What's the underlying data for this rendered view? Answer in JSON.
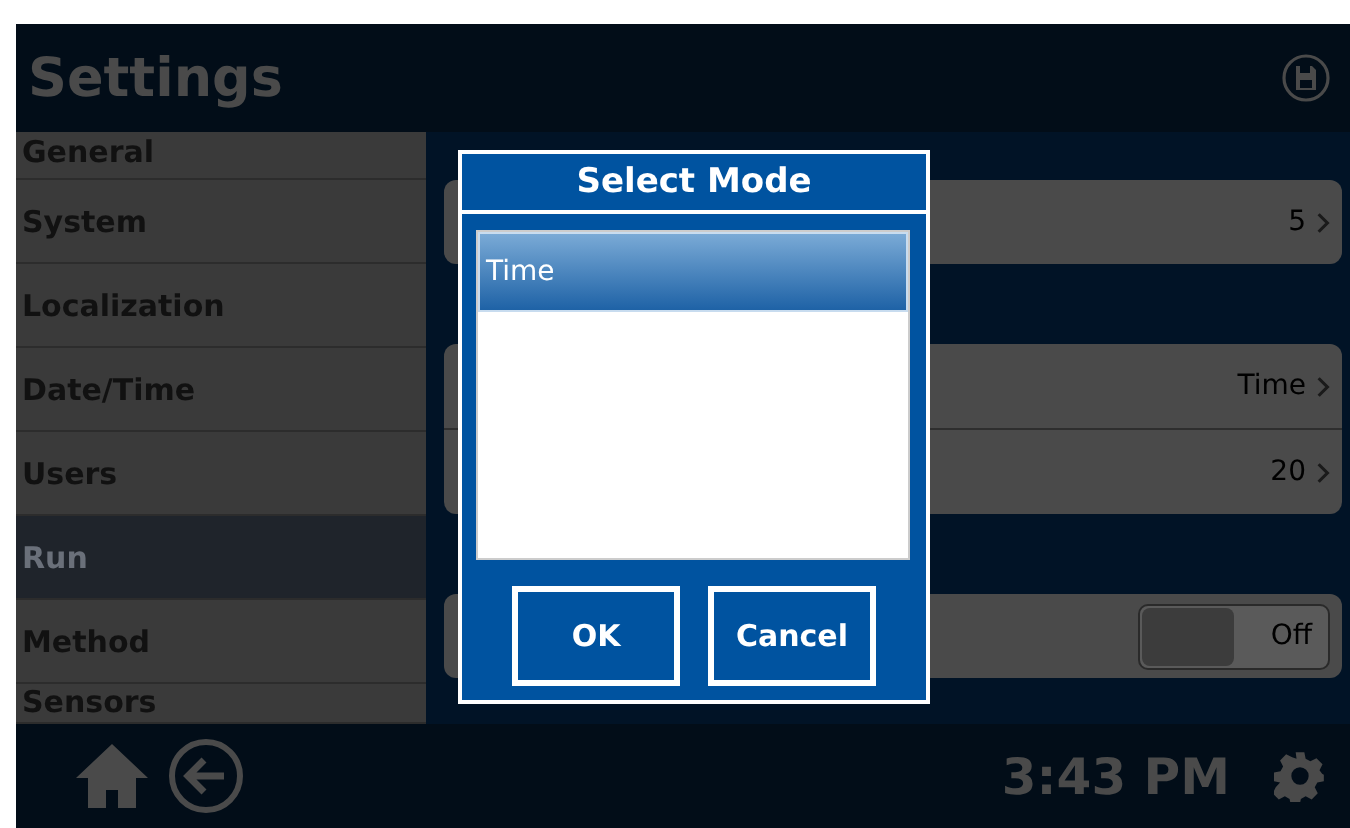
{
  "header": {
    "title": "Settings"
  },
  "sidebar": {
    "items": [
      {
        "label": "General",
        "selected": false
      },
      {
        "label": "System",
        "selected": false
      },
      {
        "label": "Localization",
        "selected": false
      },
      {
        "label": "Date/Time",
        "selected": false
      },
      {
        "label": "Users",
        "selected": false
      },
      {
        "label": "Run",
        "selected": true
      },
      {
        "label": "Method",
        "selected": false
      },
      {
        "label": "Sensors",
        "selected": false
      }
    ]
  },
  "groups": [
    {
      "rows": [
        {
          "kind": "value",
          "value": "5"
        }
      ]
    },
    {
      "rows": [
        {
          "kind": "value",
          "value": "Time"
        },
        {
          "kind": "value",
          "value": "20"
        }
      ]
    },
    {
      "rows": [
        {
          "kind": "toggle",
          "on": false,
          "label": "Off"
        }
      ]
    }
  ],
  "dialog": {
    "title": "Select Mode",
    "options": [
      {
        "label": "Time",
        "selected": true
      }
    ],
    "buttons": [
      "OK",
      "Cancel"
    ]
  },
  "status_bar": {
    "time": "3:43 PM"
  }
}
